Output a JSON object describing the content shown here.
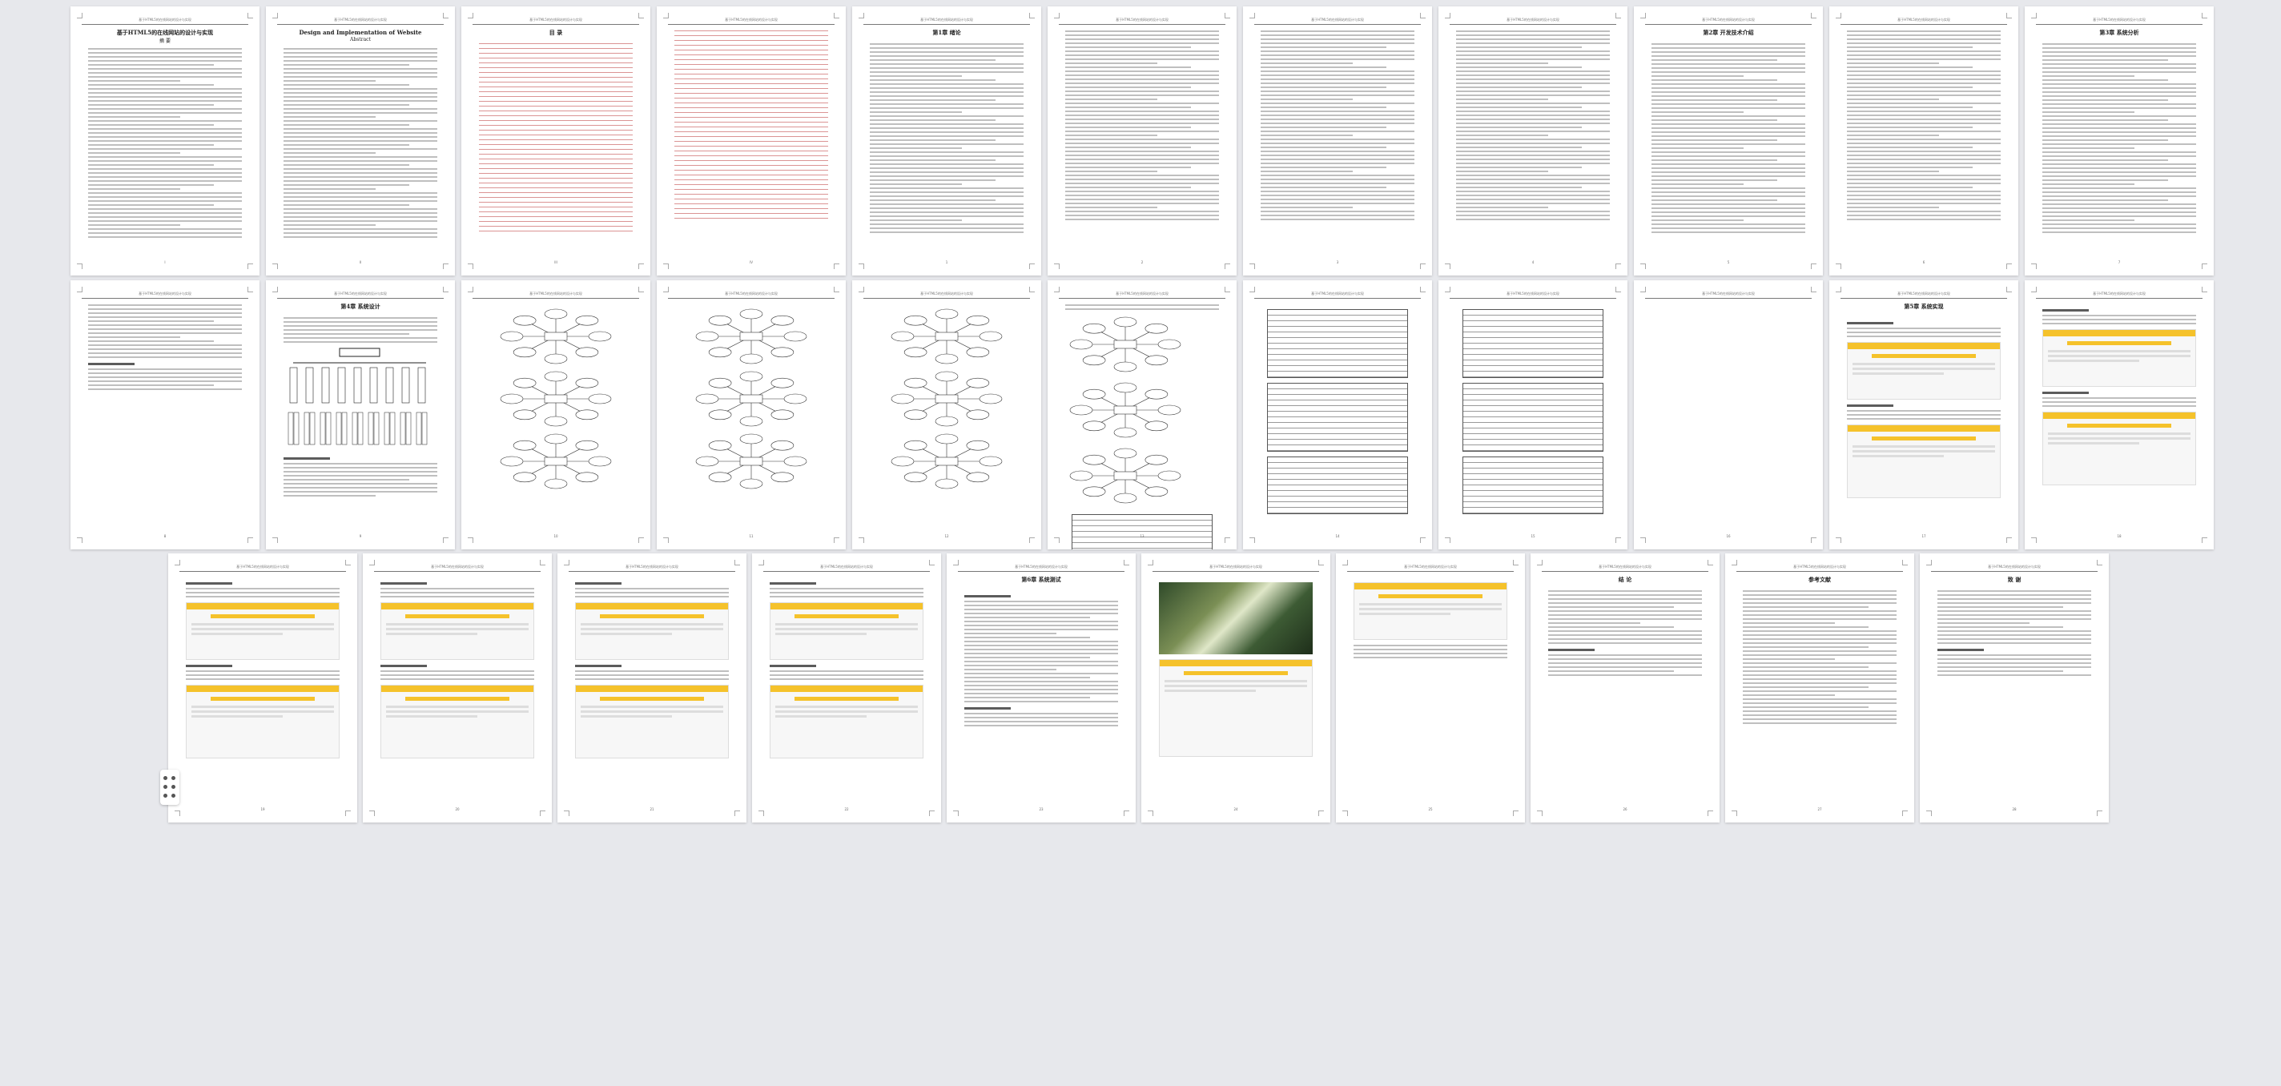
{
  "document": {
    "header_text": "基于HTML5的在线网站的设计与实现"
  },
  "pages": [
    {
      "title": "基于HTML5的在线网站的设计与实现",
      "subtitle": "摘  要",
      "kind": "text",
      "page_no": "I"
    },
    {
      "title": "Design and Implementation of Website",
      "subtitle": "Abstract",
      "kind": "text",
      "page_no": "II"
    },
    {
      "title": "目  录",
      "subtitle": "",
      "kind": "toc",
      "page_no": "III"
    },
    {
      "title": "",
      "subtitle": "",
      "kind": "toc",
      "page_no": "IV"
    },
    {
      "title": "第1章 绪论",
      "subtitle": "",
      "kind": "text",
      "page_no": "1"
    },
    {
      "title": "",
      "subtitle": "",
      "kind": "text",
      "page_no": "2"
    },
    {
      "title": "",
      "subtitle": "",
      "kind": "text",
      "page_no": "3"
    },
    {
      "title": "",
      "subtitle": "",
      "kind": "text",
      "page_no": "4"
    },
    {
      "title": "第2章 开发技术介绍",
      "subtitle": "",
      "kind": "text",
      "page_no": "5"
    },
    {
      "title": "",
      "subtitle": "",
      "kind": "text",
      "page_no": "6"
    },
    {
      "title": "第3章 系统分析",
      "subtitle": "",
      "kind": "text",
      "page_no": "7"
    },
    {
      "title": "",
      "subtitle": "",
      "kind": "text-short",
      "page_no": "8"
    },
    {
      "title": "第4章 系统设计",
      "subtitle": "",
      "kind": "tree",
      "page_no": "9"
    },
    {
      "title": "",
      "subtitle": "",
      "kind": "ellipses",
      "page_no": "10"
    },
    {
      "title": "",
      "subtitle": "",
      "kind": "ellipses",
      "page_no": "11"
    },
    {
      "title": "",
      "subtitle": "",
      "kind": "ellipses",
      "page_no": "12"
    },
    {
      "title": "",
      "subtitle": "",
      "kind": "er-table",
      "page_no": "13"
    },
    {
      "title": "",
      "subtitle": "",
      "kind": "tables",
      "page_no": "14"
    },
    {
      "title": "",
      "subtitle": "",
      "kind": "tables",
      "page_no": "15"
    },
    {
      "title": "",
      "subtitle": "",
      "kind": "blank",
      "page_no": "16"
    },
    {
      "title": "第5章 系统实现",
      "subtitle": "",
      "kind": "screens",
      "page_no": "17"
    },
    {
      "title": "",
      "subtitle": "",
      "kind": "screens",
      "page_no": "18"
    },
    {
      "title": "",
      "subtitle": "",
      "kind": "screens",
      "page_no": "19"
    },
    {
      "title": "",
      "subtitle": "",
      "kind": "screens",
      "page_no": "20"
    },
    {
      "title": "",
      "subtitle": "",
      "kind": "screens",
      "page_no": "21"
    },
    {
      "title": "",
      "subtitle": "",
      "kind": "screens",
      "page_no": "22"
    },
    {
      "title": "第6章 系统测试",
      "subtitle": "",
      "kind": "test",
      "page_no": "23"
    },
    {
      "title": "",
      "subtitle": "",
      "kind": "photo",
      "page_no": "24"
    },
    {
      "title": "",
      "subtitle": "",
      "kind": "screens-short",
      "page_no": "25"
    },
    {
      "title": "结  论",
      "subtitle": "",
      "kind": "text-short",
      "page_no": "26"
    },
    {
      "title": "参考文献",
      "subtitle": "",
      "kind": "refs",
      "page_no": "27"
    },
    {
      "title": "致  谢",
      "subtitle": "",
      "kind": "text-short",
      "page_no": "28"
    }
  ],
  "float_tool": {
    "icon": "grid-dots-icon"
  }
}
